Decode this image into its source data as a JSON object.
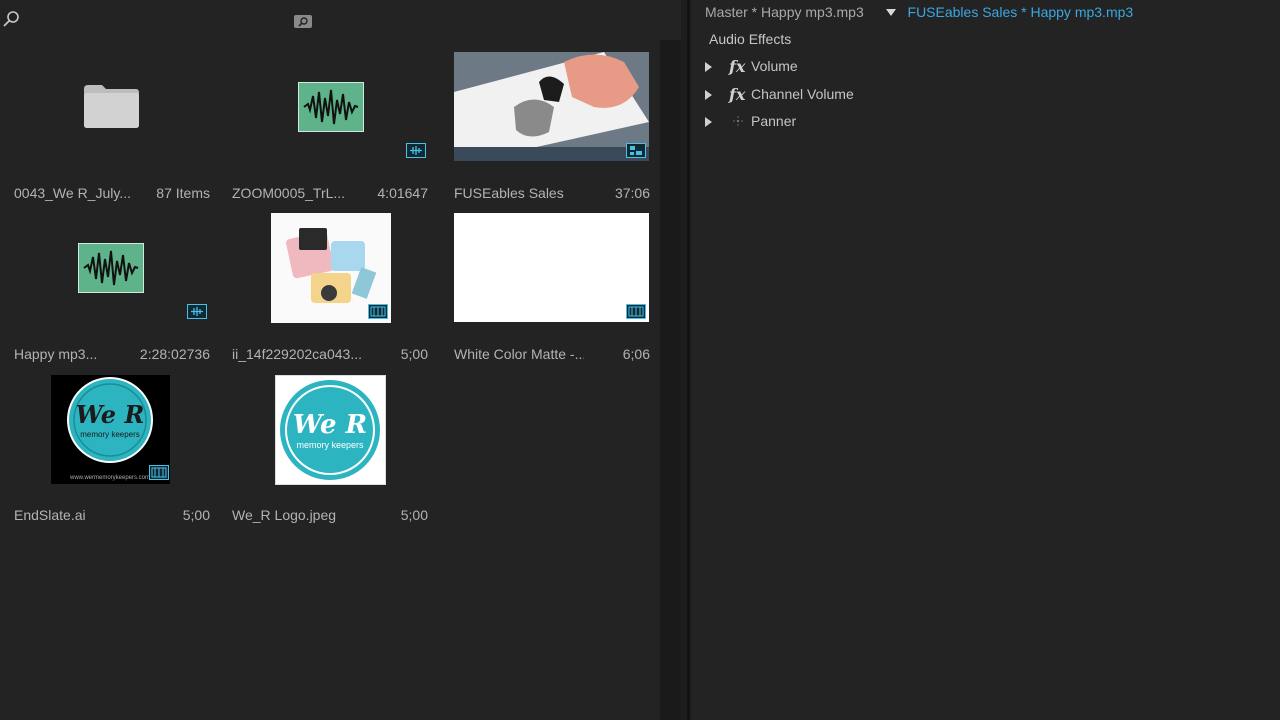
{
  "project": {
    "items": [
      {
        "name": "0043_We R_July...",
        "meta": "87 Items",
        "kind": "folder"
      },
      {
        "name": "ZOOM0005_TrL...",
        "meta": "4:01647",
        "kind": "audio"
      },
      {
        "name": "FUSEables Sales",
        "meta": "37:06",
        "kind": "sequence"
      },
      {
        "name": "Happy mp3...",
        "meta": "2:28:02736",
        "kind": "audio"
      },
      {
        "name": "ii_14f229202ca043...",
        "meta": "5;00",
        "kind": "image"
      },
      {
        "name": "White Color Matte -...",
        "meta": "6;06",
        "kind": "matte"
      },
      {
        "name": "EndSlate.ai",
        "meta": "5;00",
        "kind": "logo-dark"
      },
      {
        "name": "We_R Logo.jpeg",
        "meta": "5;00",
        "kind": "logo-light"
      }
    ],
    "logo_text": "We R",
    "logo_sub": "memory keepers",
    "logo_url": "www.wermemorykeepers.com"
  },
  "effects": {
    "master_label": "Master * Happy mp3.mp3",
    "clip_label": "FUSEables Sales * Happy mp3.mp3",
    "section_title": "Audio Effects",
    "rows": [
      {
        "label": "Volume",
        "icon": "fx"
      },
      {
        "label": "Channel Volume",
        "icon": "fx"
      },
      {
        "label": "Panner",
        "icon": "panner"
      }
    ]
  },
  "colors": {
    "background": "#232323",
    "accent_blue": "#3ba7e0",
    "audio_green": "#5fb38a",
    "logo_teal": "#2cb5c0"
  }
}
